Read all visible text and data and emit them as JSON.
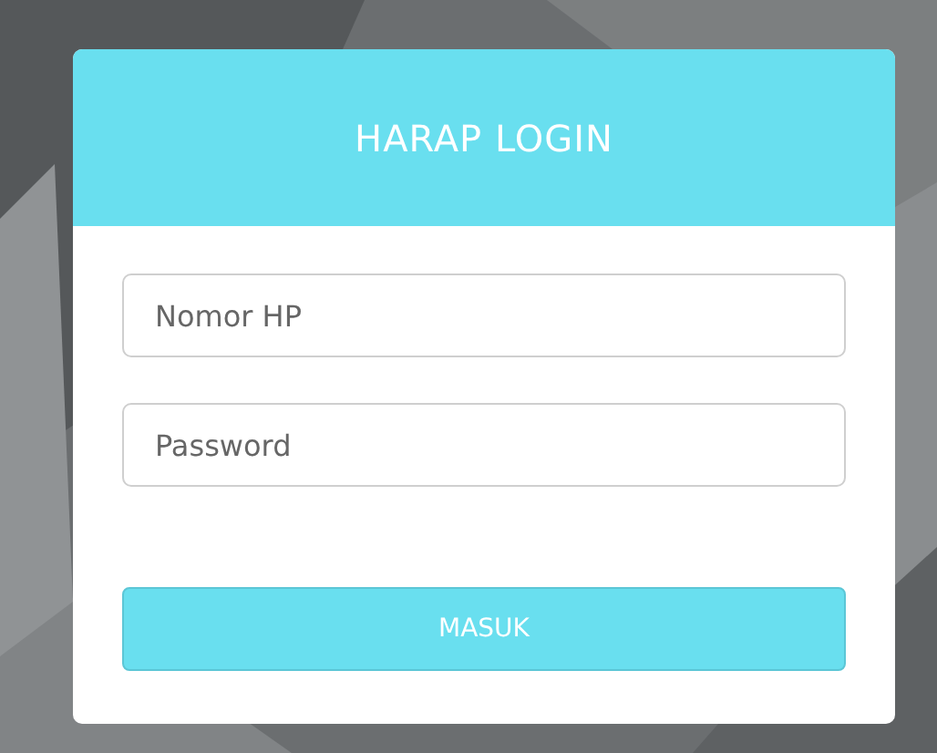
{
  "login_card": {
    "title": "HARAP LOGIN",
    "fields": [
      {
        "placeholder": "Nomor HP"
      },
      {
        "placeholder": "Password"
      }
    ],
    "submit_button": "MASUK"
  }
}
